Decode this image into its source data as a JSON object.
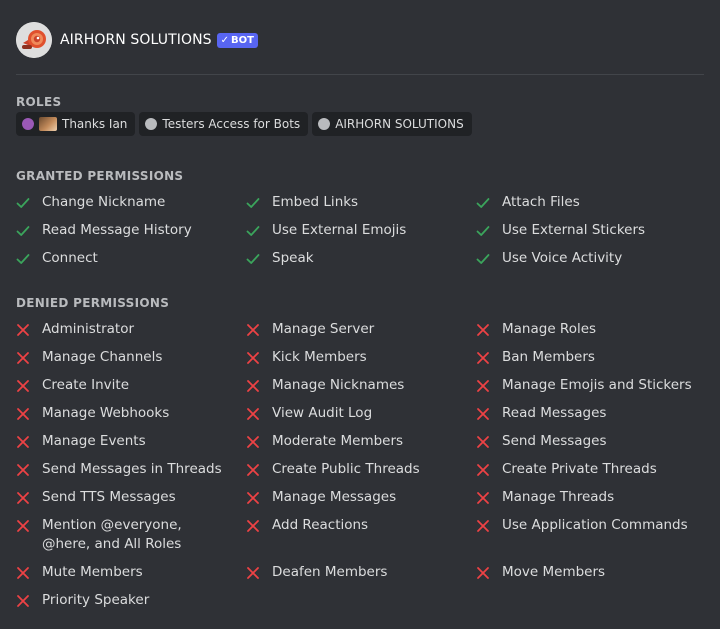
{
  "bot": {
    "name": "AIRHORN SOLUTIONS",
    "tag": "BOT",
    "avatar_icon": "airhorn-avatar-icon"
  },
  "roles": {
    "title": "ROLES",
    "items": [
      {
        "label": "Thanks Ian",
        "color": "#9b59b6",
        "has_emoji": true
      },
      {
        "label": "Testers Access for Bots",
        "color": "#b9bbbe",
        "has_emoji": false
      },
      {
        "label": "AIRHORN SOLUTIONS",
        "color": "#b9bbbe",
        "has_emoji": false
      }
    ]
  },
  "granted": {
    "title": "GRANTED PERMISSIONS",
    "icon": "check-icon",
    "color": "#3ba55c",
    "items": [
      "Change Nickname",
      "Embed Links",
      "Attach Files",
      "Read Message History",
      "Use External Emojis",
      "Use External Stickers",
      "Connect",
      "Speak",
      "Use Voice Activity"
    ]
  },
  "denied": {
    "title": "DENIED PERMISSIONS",
    "icon": "x-icon",
    "color": "#ed4245",
    "items": [
      "Administrator",
      "Manage Server",
      "Manage Roles",
      "Manage Channels",
      "Kick Members",
      "Ban Members",
      "Create Invite",
      "Manage Nicknames",
      "Manage Emojis and Stickers",
      "Manage Webhooks",
      "View Audit Log",
      "Read Messages",
      "Manage Events",
      "Moderate Members",
      "Send Messages",
      "Send Messages in Threads",
      "Create Public Threads",
      "Create Private Threads",
      "Send TTS Messages",
      "Manage Messages",
      "Manage Threads",
      "Mention @everyone, @here, and All Roles",
      "Add Reactions",
      "Use Application Commands",
      "Mute Members",
      "Deafen Members",
      "Move Members",
      "Priority Speaker"
    ]
  }
}
